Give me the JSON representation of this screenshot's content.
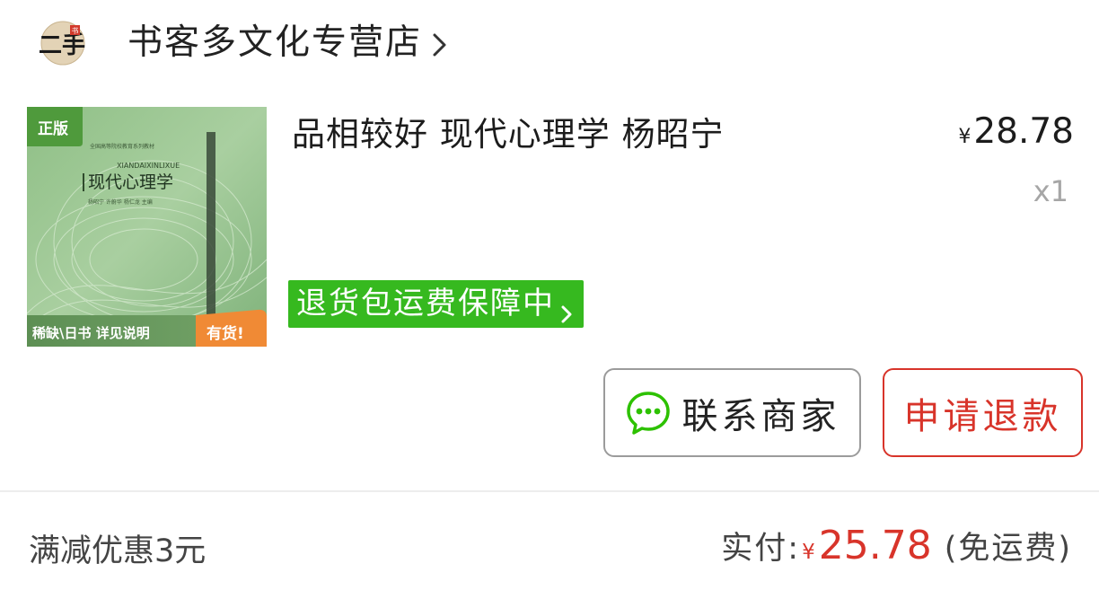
{
  "store": {
    "name": "书客多文化专营店",
    "logo_text": "二手",
    "logo_stamp": "书"
  },
  "product": {
    "title": "品相较好 现代心理学 杨昭宁",
    "price_currency": "¥",
    "price_amount": "28.78",
    "quantity": "x1",
    "return_badge": "退货包运费保障中",
    "image": {
      "corner_tag": "正版",
      "pinyin": "XIANDAIXINLIXUE",
      "book_title": "现代心理学",
      "series": "全国高等院校教育系列教材",
      "authors": "杨昭宁 许蔚华 杨仁龙 主编",
      "bottom_left": "稀缺\\日书 详见说明",
      "bottom_right": "有货!"
    }
  },
  "actions": {
    "contact_label": "联系商家",
    "refund_label": "申请退款"
  },
  "footer": {
    "discount": "满减优惠3元",
    "paid_label": "实付:",
    "paid_currency": "¥",
    "paid_amount": "25.78",
    "shipping_note": "(免运费)"
  },
  "colors": {
    "accent_red": "#d8342a",
    "badge_green": "#36b91f",
    "wechat_green": "#2dc100"
  },
  "icons": {
    "store_logo": "store-logo-icon",
    "store_chevron": "chevron-right-icon",
    "badge_chevron": "chevron-right-icon",
    "contact": "wechat-chat-icon"
  }
}
